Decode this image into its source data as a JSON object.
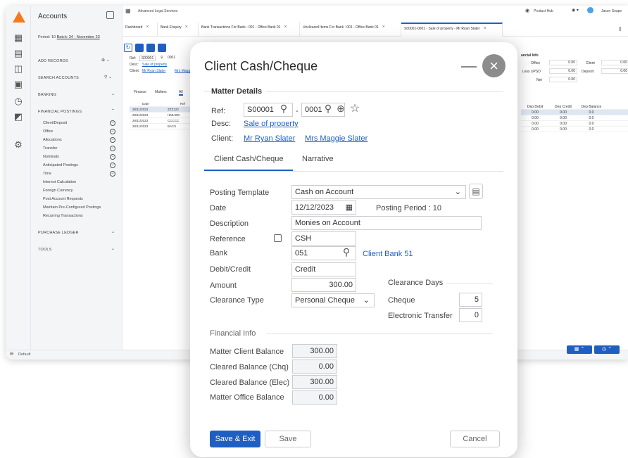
{
  "app": {
    "firm": "Advanced Legal Services",
    "product_hub": "Product Hub",
    "user": "Jason Snape",
    "default_label": "Default"
  },
  "sidebar": {
    "title": "Accounts",
    "period_prefix": "Period: 10 ",
    "period_link": "Batch: 34 - November 23",
    "add_records": "ADD RECORDS",
    "search_accounts": "SEARCH ACCOUNTS",
    "banking": "BANKING",
    "financial_postings": "FINANCIAL POSTINGS",
    "items": [
      "Client/Deposit",
      "Office",
      "Allocations",
      "Transfer",
      "Nominals",
      "Anticipated Postings",
      "Time",
      "Interest Calculation",
      "Foreign Currency",
      "Post Account Requests",
      "Maintain Pre-Configured Postings",
      "Recurring Transactions"
    ],
    "purchase_ledger": "PURCHASE LEDGER",
    "tools": "TOOLS"
  },
  "tabs": [
    {
      "label": "Dashboard"
    },
    {
      "label": "Bank Enquiry"
    },
    {
      "label": "Bank Transactions For Bank : 001 - Office Bank 01"
    },
    {
      "label": "Uncleared Items For Bank : 001 - Office Bank 01"
    },
    {
      "label": "S00001-0001 - Sale of property - Mr Ryan Slater"
    }
  ],
  "bg_matter": {
    "ref_label": "Ref:",
    "ref_value": "S00001",
    "sub_value": "0001",
    "desc_label": "Desc:",
    "desc_value": "Sale of property",
    "client_label": "Client:",
    "client1": "Mr Ryan Slater",
    "client2": "Mrs Magg",
    "subtabs": [
      "Finance",
      "Matters",
      "All"
    ],
    "cols": [
      "Date",
      "Ref"
    ],
    "rows": [
      [
        "28/11/2023",
        "ZZZ123"
      ],
      [
        "28/11/2023",
        "HML000"
      ],
      [
        "28/11/2023",
        "CCCCC"
      ],
      [
        "28/11/2023",
        "BACS"
      ]
    ]
  },
  "bg_right": {
    "title": "ancial Info",
    "office": "Office",
    "office_val": "0.00",
    "client": "Client",
    "client_val": "0.00",
    "less_upsd": "Less UPSD",
    "less_val": "0.00",
    "deposit": "Deposit",
    "deposit_val": "0.00",
    "net": "Net",
    "net_val": "0.00",
    "cols": [
      "Dep Debit",
      "Dep Credit",
      "Dep Balance"
    ],
    "rows": [
      [
        "0.00",
        "0.00",
        "0.0"
      ],
      [
        "0.00",
        "0.00",
        "0.0"
      ],
      [
        "0.00",
        "0.00",
        "0.0"
      ],
      [
        "0.00",
        "0.00",
        "0.0"
      ]
    ]
  },
  "modal": {
    "title": "Client Cash/Cheque",
    "matter_details": "Matter Details",
    "ref_label": "Ref:",
    "ref_value": "S00001",
    "ref_dash": "-",
    "sub_value": "0001",
    "desc_label": "Desc:",
    "desc_value": "Sale of property",
    "client_label": "Client:",
    "client1": "Mr Ryan Slater",
    "client2": "Mrs Maggie Slater",
    "tab1": "Client Cash/Cheque",
    "tab2": "Narrative",
    "posting_template_label": "Posting Template",
    "posting_template_value": "Cash on Account",
    "date_label": "Date",
    "date_value": "12/12/2023",
    "posting_period": "Posting Period : 10",
    "description_label": "Description",
    "description_value": "Monies on Account",
    "reference_label": "Reference",
    "reference_value": "CSH",
    "bank_label": "Bank",
    "bank_value": "051",
    "bank_name": "Client Bank 51",
    "debit_credit_label": "Debit/Credit",
    "debit_credit_value": "Credit",
    "amount_label": "Amount",
    "amount_value": "300.00",
    "clearance_days_label": "Clearance Days",
    "clearance_type_label": "Clearance Type",
    "clearance_type_value": "Personal Cheque",
    "cheque_label": "Cheque",
    "cheque_value": "5",
    "electronic_label": "Electronic Transfer",
    "electronic_value": "0",
    "financial_info": "Financial Info",
    "matter_client_balance_label": "Matter Client Balance",
    "matter_client_balance_value": "300.00",
    "cleared_chq_label": "Cleared Balance (Chq)",
    "cleared_chq_value": "0.00",
    "cleared_elec_label": "Cleared Balance (Elec)",
    "cleared_elec_value": "300.00",
    "matter_office_label": "Matter Office Balance",
    "matter_office_value": "0.00",
    "save_exit": "Save & Exit",
    "save": "Save",
    "cancel": "Cancel"
  },
  "colors": {
    "accent": "#1f5fc2",
    "brand": "#f47a20"
  }
}
